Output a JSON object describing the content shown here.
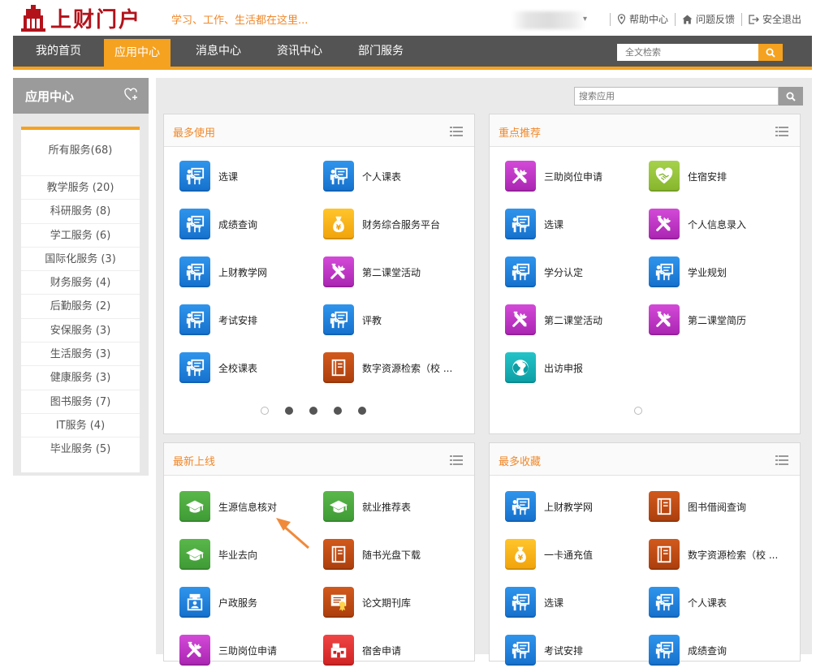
{
  "header": {
    "logo_text": "上财门户",
    "slogan": "学习、工作、生活都在这里...",
    "links": [
      {
        "icon": "location-pin-icon",
        "label": "帮助中心"
      },
      {
        "icon": "home-icon",
        "label": "问题反馈"
      },
      {
        "icon": "logout-icon",
        "label": "安全退出"
      }
    ]
  },
  "nav": {
    "items": [
      {
        "label": "我的首页"
      },
      {
        "label": "应用中心",
        "active": true
      },
      {
        "label": "消息中心"
      },
      {
        "label": "资讯中心"
      },
      {
        "label": "部门服务"
      }
    ],
    "search_placeholder": "全文检索"
  },
  "sidebar": {
    "title": "应用中心",
    "all_services": "所有服务(68)",
    "categories": [
      "教学服务 (20)",
      "科研服务 (8)",
      "学工服务 (6)",
      "国际化服务 (3)",
      "财务服务 (4)",
      "后勤服务 (2)",
      "安保服务 (3)",
      "生活服务 (3)",
      "健康服务 (3)",
      "图书服务 (7)",
      "IT服务 (4)",
      "毕业服务 (5)"
    ]
  },
  "main": {
    "search_placeholder": "搜索应用",
    "panels": {
      "most_used": {
        "title": "最多使用",
        "apps": [
          {
            "label": "选课",
            "icon": "blackboard-teacher-icon",
            "color": "blue"
          },
          {
            "label": "个人课表",
            "icon": "blackboard-teacher-icon",
            "color": "blue"
          },
          {
            "label": "成绩查询",
            "icon": "blackboard-teacher-icon",
            "color": "blue"
          },
          {
            "label": "财务综合服务平台",
            "icon": "money-bag-icon",
            "color": "yellow"
          },
          {
            "label": "上财教学网",
            "icon": "blackboard-teacher-icon",
            "color": "blue"
          },
          {
            "label": "第二课堂活动",
            "icon": "tools-icon",
            "color": "purple"
          },
          {
            "label": "考试安排",
            "icon": "blackboard-teacher-icon",
            "color": "blue"
          },
          {
            "label": "评教",
            "icon": "blackboard-teacher-icon",
            "color": "blue"
          },
          {
            "label": "全校课表",
            "icon": "blackboard-teacher-icon",
            "color": "blue"
          },
          {
            "label": "数字资源检索（校 ...",
            "icon": "book-icon",
            "color": "brown"
          }
        ]
      },
      "recommended": {
        "title": "重点推荐",
        "apps": [
          {
            "label": "三助岗位申请",
            "icon": "tools-icon",
            "color": "purple"
          },
          {
            "label": "住宿安排",
            "icon": "handshake-heart-icon",
            "color": "lgreen"
          },
          {
            "label": "选课",
            "icon": "blackboard-teacher-icon",
            "color": "blue"
          },
          {
            "label": "个人信息录入",
            "icon": "tools-icon",
            "color": "purple"
          },
          {
            "label": "学分认定",
            "icon": "blackboard-teacher-icon",
            "color": "blue"
          },
          {
            "label": "学业规划",
            "icon": "blackboard-teacher-icon",
            "color": "blue"
          },
          {
            "label": "第二课堂活动",
            "icon": "tools-icon",
            "color": "purple"
          },
          {
            "label": "第二课堂简历",
            "icon": "tools-icon",
            "color": "purple"
          },
          {
            "label": "出访申报",
            "icon": "globe-icon",
            "color": "teal"
          }
        ]
      },
      "newest": {
        "title": "最新上线",
        "apps": [
          {
            "label": "生源信息核对",
            "icon": "graduation-cap-icon",
            "color": "dgreen"
          },
          {
            "label": "就业推荐表",
            "icon": "graduation-cap-icon",
            "color": "dgreen"
          },
          {
            "label": "毕业去向",
            "icon": "graduation-cap-icon",
            "color": "dgreen"
          },
          {
            "label": "随书光盘下载",
            "icon": "book-icon",
            "color": "brown"
          },
          {
            "label": "户政服务",
            "icon": "id-badge-icon",
            "color": "blue"
          },
          {
            "label": "论文期刊库",
            "icon": "certificate-icon",
            "color": "brown"
          },
          {
            "label": "三助岗位申请",
            "icon": "tools-icon",
            "color": "purple"
          },
          {
            "label": "宿舍申请",
            "icon": "dorm-icon",
            "color": "red"
          }
        ]
      },
      "most_favorited": {
        "title": "最多收藏",
        "apps": [
          {
            "label": "上财教学网",
            "icon": "blackboard-teacher-icon",
            "color": "blue"
          },
          {
            "label": "图书借阅查询",
            "icon": "book-icon",
            "color": "brown"
          },
          {
            "label": "一卡通充值",
            "icon": "money-bag-icon",
            "color": "yellow"
          },
          {
            "label": "数字资源检索（校 ...",
            "icon": "book-icon",
            "color": "brown"
          },
          {
            "label": "选课",
            "icon": "blackboard-teacher-icon",
            "color": "blue"
          },
          {
            "label": "个人课表",
            "icon": "blackboard-teacher-icon",
            "color": "blue"
          },
          {
            "label": "考试安排",
            "icon": "blackboard-teacher-icon",
            "color": "blue"
          },
          {
            "label": "成绩查询",
            "icon": "blackboard-teacher-icon",
            "color": "blue"
          }
        ]
      }
    }
  },
  "colors": {
    "accent": "#f5a220",
    "nav_bg": "#545454",
    "title_orange": "#f0882a",
    "brand_red": "#b3121b"
  }
}
